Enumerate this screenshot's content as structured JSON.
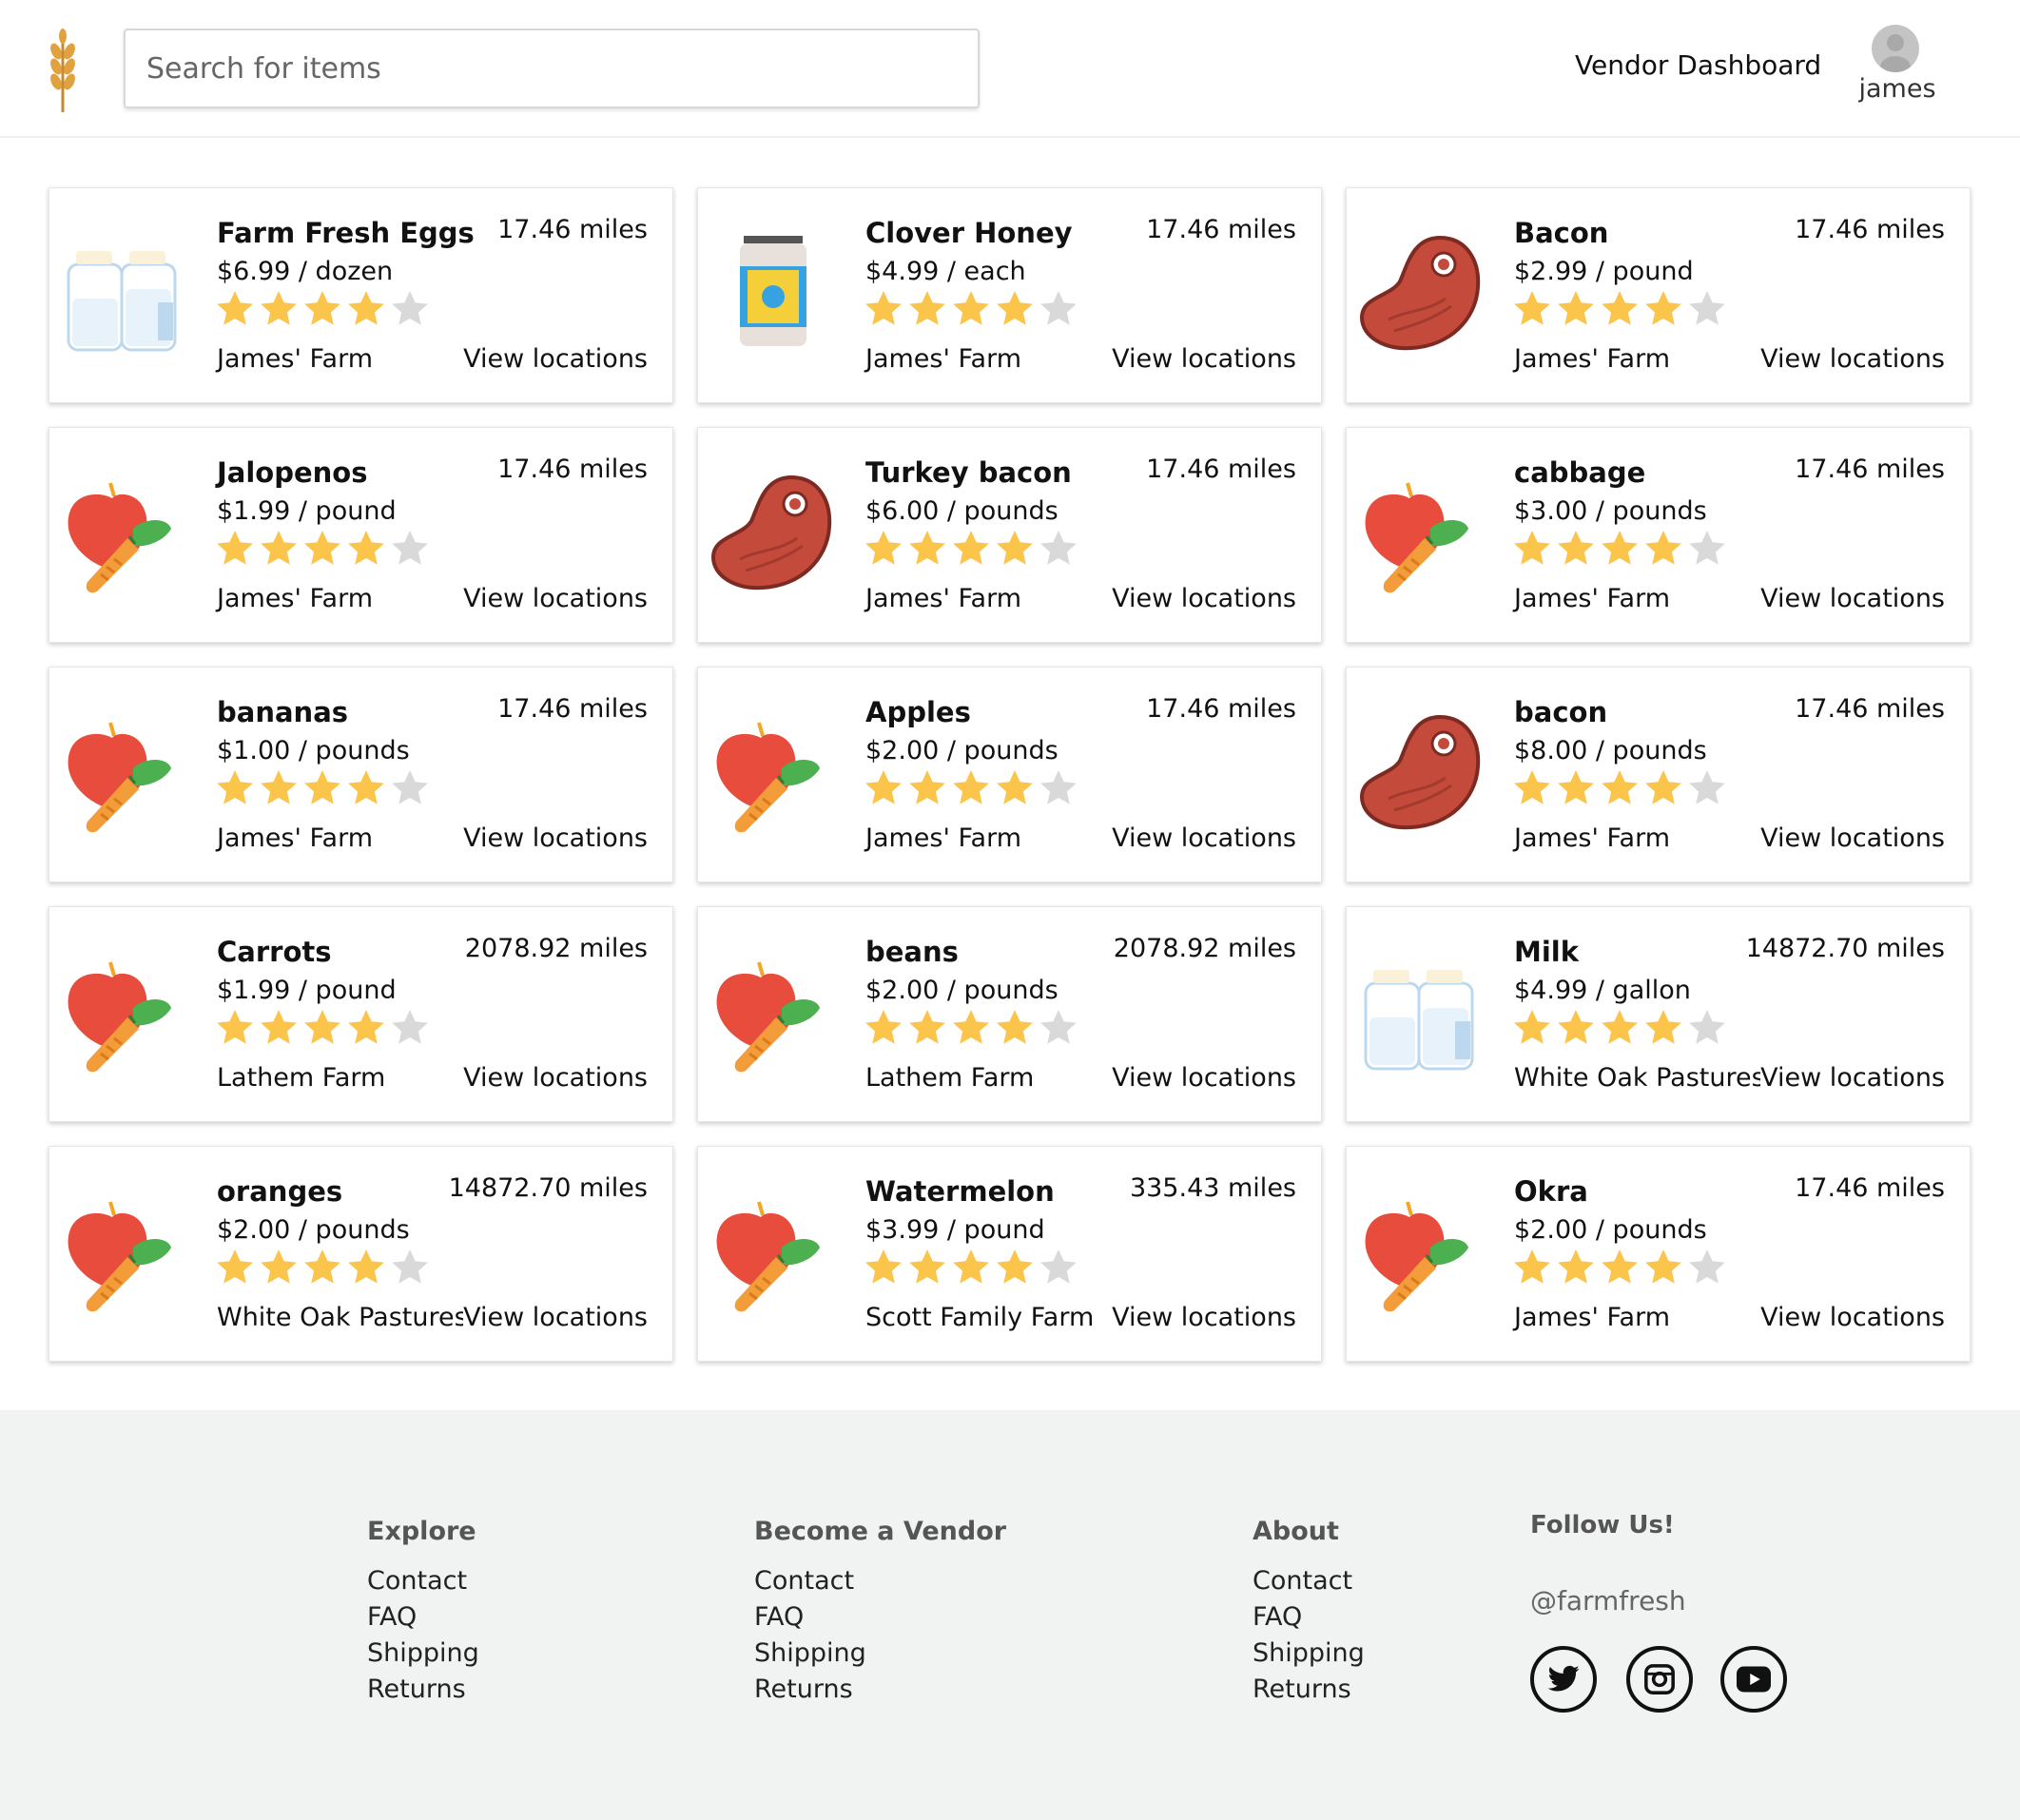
{
  "header": {
    "search_placeholder": "Search for items",
    "vendor_dashboard": "Vendor Dashboard",
    "username": "james"
  },
  "products": [
    {
      "name": "Farm Fresh Eggs",
      "price": "$6.99 / dozen",
      "distance": "17.46 miles",
      "farm": "James' Farm",
      "view": "View locations",
      "rating": 4,
      "icon": "milk-bottles-icon"
    },
    {
      "name": "Clover Honey",
      "price": "$4.99 / each",
      "distance": "17.46 miles",
      "farm": "James' Farm",
      "view": "View locations",
      "rating": 4,
      "icon": "honey-jar-icon"
    },
    {
      "name": "Bacon",
      "price": "$2.99 / pound",
      "distance": "17.46 miles",
      "farm": "James' Farm",
      "view": "View locations",
      "rating": 4,
      "icon": "meat-steak-icon"
    },
    {
      "name": "Jalopenos",
      "price": "$1.99 / pound",
      "distance": "17.46 miles",
      "farm": "James' Farm",
      "view": "View locations",
      "rating": 4,
      "icon": "produce-icon"
    },
    {
      "name": "Turkey bacon",
      "price": "$6.00 / pounds",
      "distance": "17.46 miles",
      "farm": "James' Farm",
      "view": "View locations",
      "rating": 4,
      "icon": "meat-steak-icon"
    },
    {
      "name": "cabbage",
      "price": "$3.00 / pounds",
      "distance": "17.46 miles",
      "farm": "James' Farm",
      "view": "View locations",
      "rating": 4,
      "icon": "produce-icon"
    },
    {
      "name": "bananas",
      "price": "$1.00 / pounds",
      "distance": "17.46 miles",
      "farm": "James' Farm",
      "view": "View locations",
      "rating": 4,
      "icon": "produce-icon"
    },
    {
      "name": "Apples",
      "price": "$2.00 / pounds",
      "distance": "17.46 miles",
      "farm": "James' Farm",
      "view": "View locations",
      "rating": 4,
      "icon": "produce-icon"
    },
    {
      "name": "bacon",
      "price": "$8.00 / pounds",
      "distance": "17.46 miles",
      "farm": "James' Farm",
      "view": "View locations",
      "rating": 4,
      "icon": "meat-steak-icon"
    },
    {
      "name": "Carrots",
      "price": "$1.99 / pound",
      "distance": "2078.92 miles",
      "farm": "Lathem Farm",
      "view": "View locations",
      "rating": 4,
      "icon": "produce-icon"
    },
    {
      "name": "beans",
      "price": "$2.00 / pounds",
      "distance": "2078.92 miles",
      "farm": "Lathem Farm",
      "view": "View locations",
      "rating": 4,
      "icon": "produce-icon"
    },
    {
      "name": "Milk",
      "price": "$4.99 / gallon",
      "distance": "14872.70 miles",
      "farm": "White Oak Pastures",
      "view": "View locations",
      "rating": 4,
      "icon": "milk-bottles-icon"
    },
    {
      "name": "oranges",
      "price": "$2.00 / pounds",
      "distance": "14872.70 miles",
      "farm": "White Oak Pastures",
      "view": "View locations",
      "rating": 4,
      "icon": "produce-icon"
    },
    {
      "name": "Watermelon",
      "price": "$3.99 / pound",
      "distance": "335.43 miles",
      "farm": "Scott Family Farm",
      "view": "View locations",
      "rating": 4,
      "icon": "produce-icon"
    },
    {
      "name": "Okra",
      "price": "$2.00 / pounds",
      "distance": "17.46 miles",
      "farm": "James' Farm",
      "view": "View locations",
      "rating": 4,
      "icon": "produce-icon"
    }
  ],
  "footer": {
    "columns": [
      {
        "heading": "Explore",
        "links": [
          "Contact",
          "FAQ",
          "Shipping",
          "Returns"
        ]
      },
      {
        "heading": "Become a Vendor",
        "links": [
          "Contact",
          "FAQ",
          "Shipping",
          "Returns"
        ]
      },
      {
        "heading": "About",
        "links": [
          "Contact",
          "FAQ",
          "Shipping",
          "Returns"
        ]
      }
    ],
    "follow_heading": "Follow Us!",
    "handle": "@farmfresh",
    "social": [
      "twitter-icon",
      "instagram-icon",
      "youtube-icon"
    ]
  },
  "colors": {
    "star_filled": "#fbc54b",
    "star_empty": "#d9d9d9",
    "footer_bg": "#f1f2f2",
    "logo_wheat": "#d99a3a"
  }
}
